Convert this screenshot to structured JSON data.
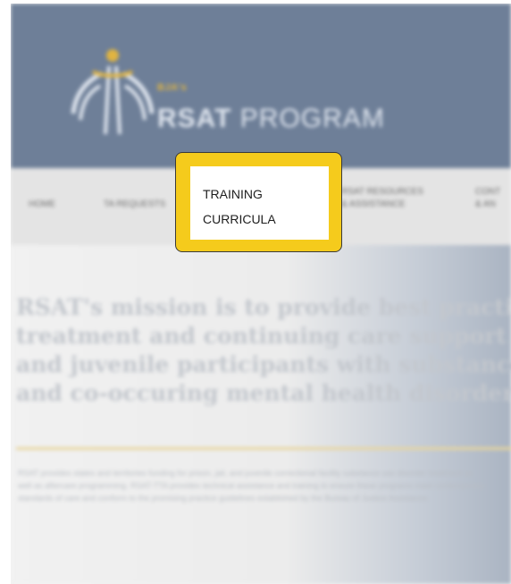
{
  "site": {
    "logo_small": "BJA's",
    "logo_title_bold": "RSAT",
    "logo_title_rest": "PROGRAM",
    "accent_color": "#f5cb1c",
    "header_color": "#6e7f98"
  },
  "nav": {
    "home": "HOME",
    "ta": "TA REQUESTS",
    "res_line1": "RSAT RESOURCES",
    "res_line2": "& ASSISTANCE",
    "con_line1": "CONT",
    "con_line2": "& AN"
  },
  "callout": {
    "line1": "TRAINING",
    "line2": "CURRICULA"
  },
  "hero": {
    "mission_lines": [
      "RSAT's mission is to provide best practic",
      "treatment and continuing care support t",
      "and juvenile participants with substance",
      "and co-occuring mental health disorder"
    ],
    "paragraph": "RSAT provides states and territories funding for prison, jail, and juvenile correctional facility substance use disorder treatment as well as aftercare programming. RSAT-TTA provides technical assistance and training to ensure these programs meet contemporary standards of care and conform to the promising practice guidelines established by the Bureau of Justice Assistance."
  }
}
